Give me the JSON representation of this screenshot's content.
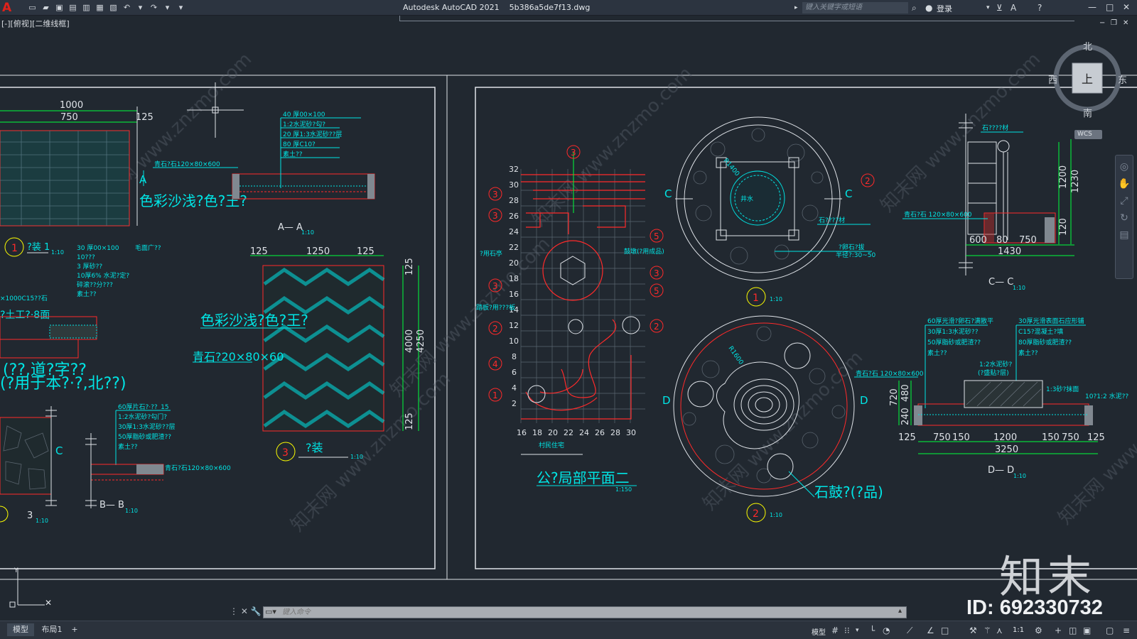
{
  "app": {
    "logo": "A",
    "title": "Autodesk AutoCAD 2021",
    "filename": "5b386a5de7f13.dwg",
    "view_label": "[-][俯视][二维线框]"
  },
  "search": {
    "placeholder": "键入关键字或短语"
  },
  "header": {
    "login_label": "登录"
  },
  "viewcube": {
    "north": "北",
    "south": "南",
    "east": "东",
    "west": "西",
    "face": "上",
    "wcs": "WCS"
  },
  "drawing": {
    "colors": {
      "background": "#212830",
      "frame": "#ffffff",
      "cyan": "#00e5e5",
      "red": "#ff2a2a",
      "green": "#00ff3c",
      "yellow": "#ffff00",
      "magenta": "#ff00ff"
    },
    "left_panel": {
      "dim_1000": "1000",
      "dim_750": "750",
      "dim_125": "125",
      "mark_A": "A",
      "callout_stone": "青石?石120×80×600",
      "paving_text": "色彩沙浅?色?王?",
      "layers_AA": [
        "40 厚00×100",
        "1:2水泥砂?勾?",
        "20 厚1:3水泥砂??层",
        "80 厚C10?",
        "素土??"
      ],
      "label_AA": "A— A",
      "scale_AA": "1:10",
      "detail1_label": "?装 1",
      "detail1_scale": "1:10",
      "layers_mid": [
        "30 厚00×100",
        "10???",
        "3 厚砂??",
        "10厚6% 水泥?定?",
        "碎滚??分???",
        "素土??"
      ],
      "mid_note": "毛面广??",
      "left_note1": "×1000C15??石",
      "left_note2": "?土工?·8面",
      "dims_1250": [
        "125",
        "1250",
        "125"
      ],
      "dim_4000": "4000",
      "dim_4250": "4250",
      "dim_125r": "125",
      "dim_125b": "125",
      "paving_text2": "色彩沙浅?色?王?",
      "stone_text": "青石?20×80×60",
      "big_note1": "(??,道?字??",
      "big_note2": "(?用于本?·?,北??)",
      "layers_BB": [
        "60厚片石?·??_15",
        "1:2水泥砂?勾门?",
        "30厚1:3水泥砂??层",
        "50厚脂砂或肥渣??",
        "素土??"
      ],
      "callout_BB": "青石?石120×80×600",
      "mark_C": "C",
      "label_BB": "B— B",
      "scale_BB": "1:10",
      "detail3_label": "?装",
      "detail3_scale": "1:10",
      "detail3_num": "3",
      "num3_left": "3",
      "num3_left_scale": "1:10"
    },
    "right_panel": {
      "plan_ylabels": [
        "32",
        "30",
        "28",
        "26",
        "24",
        "22",
        "20",
        "18",
        "16",
        "14",
        "12",
        "10",
        "8",
        "6",
        "4",
        "2"
      ],
      "plan_xlabels": [
        "16",
        "18",
        "20",
        "22",
        "24",
        "26",
        "28",
        "30"
      ],
      "plan_note_left1": "?用石亭",
      "plan_note_left2": "踏板?用???板",
      "plan_note_right": "鼓墩(?用成品)",
      "plan_note_bottom": "村民住宅",
      "plan_title": "公?局部平面二",
      "plan_scale": "1:150",
      "circle1_radius": "R1400",
      "circle1_center": "井水",
      "circle1_note1": "石????材",
      "circle1_note2": "?卵石?拔",
      "circle1_note3": "半径?:30~50",
      "circle1_mark": "C",
      "detail_1_num": "1",
      "detail_1_scale": "1:10",
      "circle2_radius": "R1600",
      "circle2_mark": "D",
      "stone_drum": "石鼓?(?品)",
      "detail_2_num": "2",
      "detail_2_scale": "1:10",
      "cc_note1": "石????材",
      "cc_note2": "青石?石 120×80×600",
      "cc_dims": [
        "600",
        "80",
        "750"
      ],
      "cc_total": "1430",
      "cc_h1": "1200",
      "cc_h2": "1230",
      "cc_h3": "120",
      "label_CC": "C— C",
      "scale_CC": "1:10",
      "dd_layers_left": [
        "60厚光滑?卵石?满散平",
        "30厚1:3水泥砂??",
        "50厚脂砂或肥渣??",
        "素土??"
      ],
      "dd_layers_right": [
        "30厚光滑表面石应形铺",
        "C15?混凝土?填",
        "80厚脂砂或肥渣??",
        "素土??"
      ],
      "dd_callout": "青石?石 120×80×600",
      "dd_note1": "1:2水泥砂?",
      "dd_note2": "(?盛贴?层)",
      "dd_note3": "1:3砂?抹面",
      "dd_note4": "10?1:2 水泥??",
      "dd_dims": [
        "125",
        "750",
        "150",
        "1200",
        "150",
        "750",
        "125"
      ],
      "dd_total": "3250",
      "dd_h": [
        "720",
        "240",
        "480"
      ],
      "label_DD": "D— D",
      "scale_DD": "1:10"
    },
    "watermarks": [
      "知末网 www.znzmo.com"
    ]
  },
  "command": {
    "placeholder": "键入命令"
  },
  "status": {
    "tabs": [
      "模型",
      "布局1"
    ],
    "add_tab": "+",
    "model_label": "模型",
    "scale_label": "1:1"
  },
  "brand": {
    "logo_text": "知末",
    "id_text": "ID: 692330732"
  }
}
